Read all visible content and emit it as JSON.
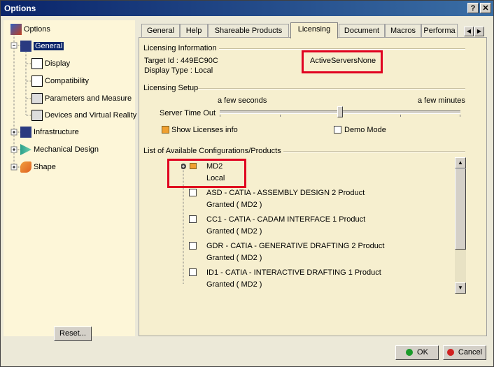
{
  "window": {
    "title": "Options",
    "help_label": "?",
    "close_label": "✕"
  },
  "tree": {
    "root": "Options",
    "items": [
      {
        "label": "General"
      },
      {
        "label": "Display"
      },
      {
        "label": "Compatibility"
      },
      {
        "label": "Parameters and Measure"
      },
      {
        "label": "Devices and Virtual Reality"
      },
      {
        "label": "Infrastructure"
      },
      {
        "label": "Mechanical Design"
      },
      {
        "label": "Shape"
      }
    ],
    "reset_label": "Reset..."
  },
  "tabs": [
    "General",
    "Help",
    "Shareable Products",
    "Licensing",
    "Document",
    "Macros",
    "Performa"
  ],
  "active_tab": "Licensing",
  "licensing_info": {
    "header": "Licensing Information",
    "target_id": "Target Id : 449EC90C",
    "display_type": "Display Type : Local",
    "servers": "ActiveServersNone"
  },
  "licensing_setup": {
    "header": "Licensing Setup",
    "min_label": "a few seconds",
    "max_label": "a few minutes",
    "timeout_label": "Server Time Out",
    "slider_value_fraction": 0.5,
    "show_licenses_label": "Show Licenses info",
    "show_licenses_checked": true,
    "demo_mode_label": "Demo Mode",
    "demo_mode_checked": false
  },
  "products": {
    "header": "List of Available Configurations/Products",
    "config": {
      "name": "MD2",
      "sub": "Local"
    },
    "items": [
      {
        "name": "ASD - CATIA - ASSEMBLY DESIGN 2 Product",
        "status": "Granted ( MD2 )"
      },
      {
        "name": "CC1 - CATIA - CADAM INTERFACE 1 Product",
        "status": "Granted ( MD2 )"
      },
      {
        "name": "GDR - CATIA - GENERATIVE DRAFTING 2 Product",
        "status": "Granted ( MD2 )"
      },
      {
        "name": "ID1 - CATIA - INTERACTIVE DRAFTING 1 Product",
        "status": "Granted ( MD2 )"
      }
    ]
  },
  "buttons": {
    "ok": "OK",
    "cancel": "Cancel"
  },
  "colors": {
    "title_bar": "#0a246a",
    "panel_bg": "#f6efcf",
    "highlight_box": "#e00020",
    "ok_dot": "#1a9a2a",
    "cancel_dot": "#d02020"
  }
}
